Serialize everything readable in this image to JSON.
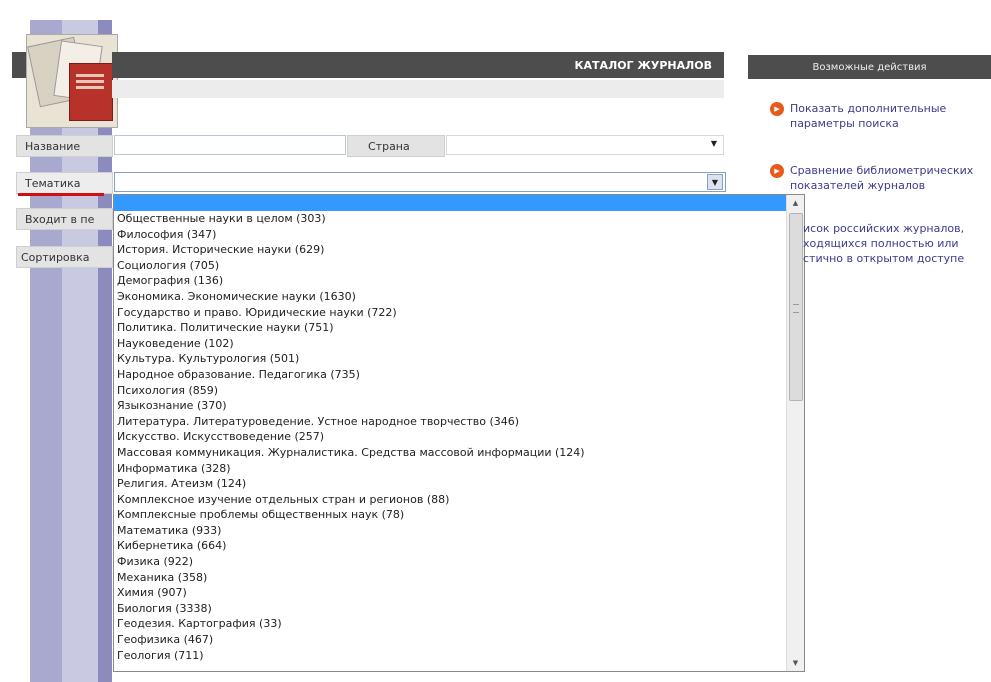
{
  "header": {
    "title": "КАТАЛОГ ЖУРНАЛОВ"
  },
  "form": {
    "name_label": "Название",
    "country_label": "Страна",
    "subject_label": "Тематика",
    "included_label": "Входит в пе",
    "sort_label": "Сортировка"
  },
  "dropdown": {
    "items": [
      "Общественные науки в целом  (303)",
      "Философия  (347)",
      "История. Исторические науки  (629)",
      "Социология  (705)",
      "Демография  (136)",
      "Экономика. Экономические науки  (1630)",
      "Государство и право. Юридические науки  (722)",
      "Политика. Политические науки  (751)",
      "Науковедение  (102)",
      "Культура. Культурология  (501)",
      "Народное образование. Педагогика  (735)",
      "Психология  (859)",
      "Языкознание  (370)",
      "Литература. Литературоведение. Устное народное творчество  (346)",
      "Искусство. Искусствоведение  (257)",
      "Массовая коммуникация. Журналистика. Средства массовой информации  (124)",
      "Информатика  (328)",
      "Религия. Атеизм  (124)",
      "Комплексное изучение отдельных стран и регионов  (88)",
      "Комплексные проблемы общественных наук  (78)",
      "Математика  (933)",
      "Кибернетика  (664)",
      "Физика  (922)",
      "Механика  (358)",
      "Химия  (907)",
      "Биология  (3338)",
      "Геодезия. Картография  (33)",
      "Геофизика  (467)",
      "Геология  (711)"
    ]
  },
  "actions": {
    "header": "Возможные действия",
    "items": [
      "Показать дополнительные параметры поиска",
      "Сравнение библиометрических показателей журналов",
      "исок российских журналов, ходящихся полностью или стично в открытом доступе"
    ]
  },
  "colors": {
    "accent": "#e85a1b",
    "highlight": "#3399ff",
    "header": "#4d4d4d",
    "link": "#3b3b8c"
  },
  "icons": {
    "action_bullet": "arrow-circle-icon",
    "dropdown_arrow": "chevron-down-icon"
  }
}
